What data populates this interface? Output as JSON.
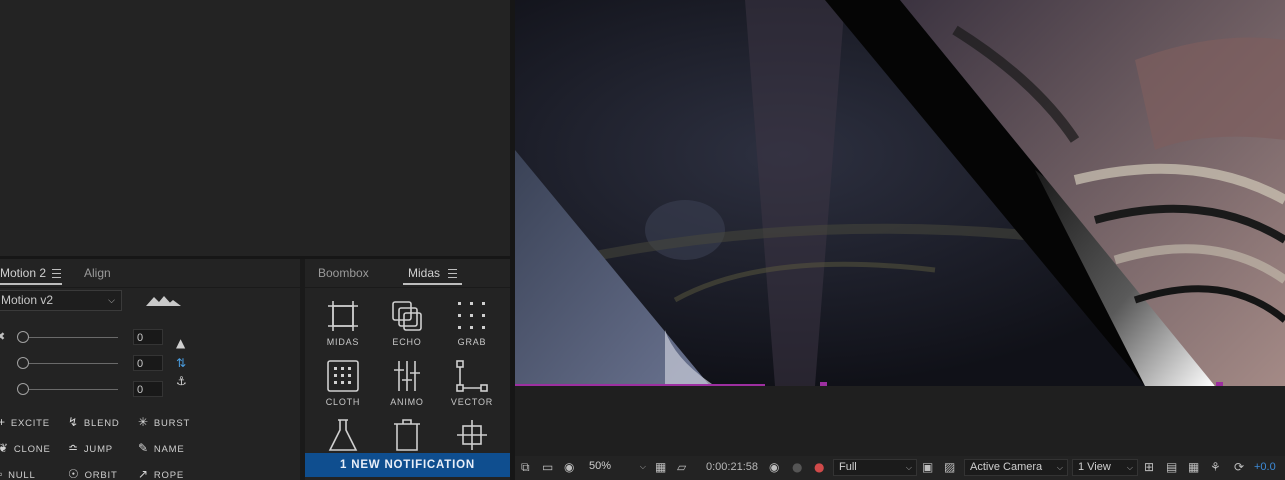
{
  "motion_panel": {
    "tab_active": "Motion 2",
    "tab_other": "Align",
    "preset_select": "Motion v2",
    "slider_values": [
      "0",
      "0",
      "0"
    ],
    "actions": [
      {
        "label": "EXCITE",
        "icon": "plus-icon"
      },
      {
        "label": "BLEND",
        "icon": "blend-icon"
      },
      {
        "label": "BURST",
        "icon": "burst-icon"
      },
      {
        "label": "CLONE",
        "icon": "clone-icon"
      },
      {
        "label": "JUMP",
        "icon": "jump-icon"
      },
      {
        "label": "NAME",
        "icon": "pencil-icon"
      },
      {
        "label": "NULL",
        "icon": "null-icon"
      },
      {
        "label": "ORBIT",
        "icon": "orbit-icon"
      },
      {
        "label": "ROPE",
        "icon": "rope-icon"
      }
    ]
  },
  "midas_panel": {
    "tab_other": "Boombox",
    "tab_active": "Midas",
    "tools": [
      {
        "label": "MIDAS",
        "icon": "midas-icon"
      },
      {
        "label": "ECHO",
        "icon": "echo-icon"
      },
      {
        "label": "GRAB",
        "icon": "grab-icon"
      },
      {
        "label": "CLOTH",
        "icon": "cloth-icon"
      },
      {
        "label": "ANIMO",
        "icon": "animo-icon"
      },
      {
        "label": "VECTOR",
        "icon": "vector-icon"
      },
      {
        "label": "",
        "icon": "flask-icon"
      },
      {
        "label": "",
        "icon": "trash-icon"
      },
      {
        "label": "",
        "icon": "anchor-point-icon"
      }
    ],
    "notification": "1 NEW NOTIFICATION"
  },
  "viewer_toolbar": {
    "zoom": "50%",
    "timecode": "0:00:21:58",
    "resolution": "Full",
    "camera": "Active Camera",
    "views": "1 View",
    "exposure": "+0.0"
  },
  "colors": {
    "accent_blue": "#0f4e8f",
    "layer_handle": "#9d2fa0",
    "exposure_text": "#3d8bd8"
  }
}
